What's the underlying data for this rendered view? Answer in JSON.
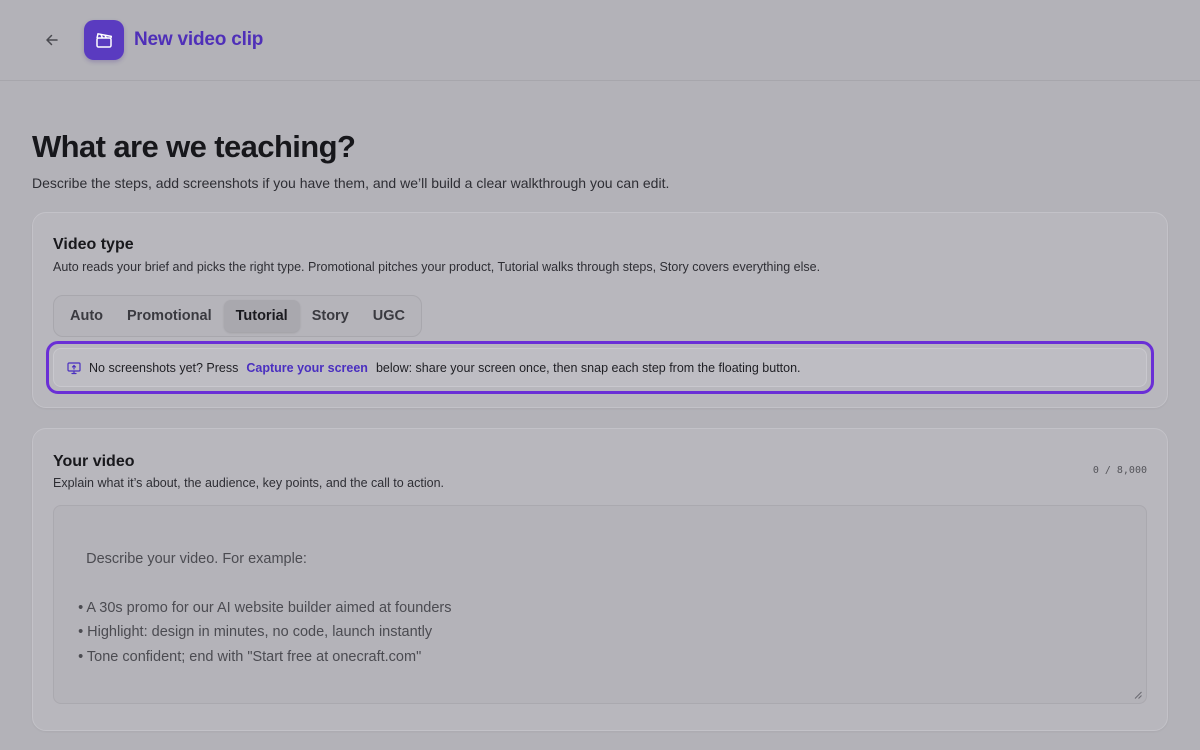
{
  "header": {
    "back_icon": "arrow-left-icon",
    "app_icon": "clapperboard-icon",
    "title": "New video clip"
  },
  "page": {
    "title": "What are we teaching?",
    "subtitle": "Describe the steps, add screenshots if you have them, and we’ll build a clear walkthrough you can edit."
  },
  "video_type": {
    "title": "Video type",
    "description": "Auto reads your brief and picks the right type. Promotional pitches your product, Tutorial walks through steps, Story covers everything else.",
    "options": [
      "Auto",
      "Promotional",
      "Tutorial",
      "Story",
      "UGC"
    ],
    "selected": "Tutorial",
    "hint": {
      "icon": "screen-capture-icon",
      "before": "No screenshots yet? Press",
      "link": "Capture your screen",
      "after": "below: share your screen once, then snap each step from the floating button."
    }
  },
  "your_video": {
    "title": "Your video",
    "description": "Explain what it’s about, the audience, key points, and the call to action.",
    "counter": "0 / 8,000",
    "value": "",
    "placeholder": "Describe your video. For example:\n\n  • A 30s promo for our AI website builder aimed at founders\n  • Highlight: design in minutes, no code, launch instantly\n  • Tone confident; end with \"Start free at onecraft.com\""
  },
  "colors": {
    "accent": "#5a3bc0",
    "focus_ring": "#6a2fd6",
    "link": "#4a2fc0"
  }
}
